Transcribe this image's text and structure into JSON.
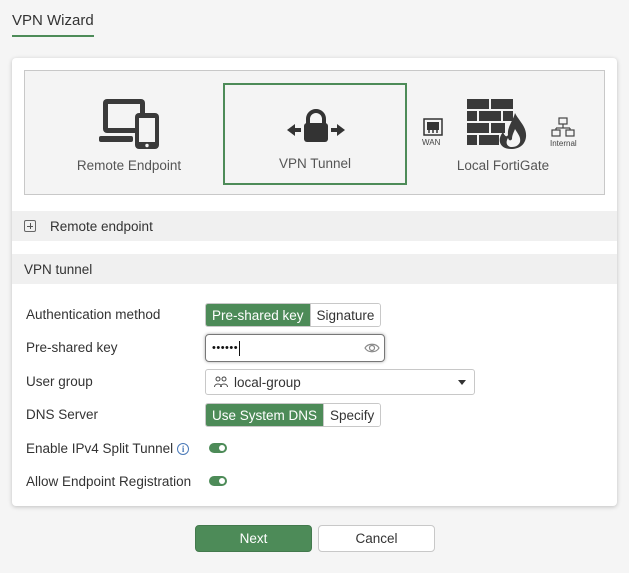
{
  "page": {
    "title": "VPN Wizard"
  },
  "diagram": {
    "remote_endpoint_label": "Remote Endpoint",
    "vpn_tunnel_label": "VPN Tunnel",
    "local_fortigate_label": "Local FortiGate",
    "wan_label": "WAN",
    "internal_label": "Internal",
    "selected": "VPN Tunnel"
  },
  "sections": {
    "remote_endpoint": "Remote endpoint",
    "vpn_tunnel": "VPN tunnel"
  },
  "form": {
    "auth_method": {
      "label": "Authentication method",
      "options": [
        "Pre-shared key",
        "Signature"
      ],
      "selected": "Pre-shared key"
    },
    "psk": {
      "label": "Pre-shared key",
      "masked_value": "••••••"
    },
    "user_group": {
      "label": "User group",
      "value": "local-group"
    },
    "dns": {
      "label": "DNS Server",
      "options": [
        "Use System DNS",
        "Specify"
      ],
      "selected": "Use System DNS"
    },
    "split_tunnel": {
      "label": "Enable IPv4 Split Tunnel",
      "enabled": true
    },
    "endpoint_reg": {
      "label": "Allow Endpoint Registration",
      "enabled": true
    }
  },
  "buttons": {
    "next": "Next",
    "cancel": "Cancel"
  },
  "colors": {
    "accent": "#4d8b58",
    "info": "#4a79b8"
  }
}
